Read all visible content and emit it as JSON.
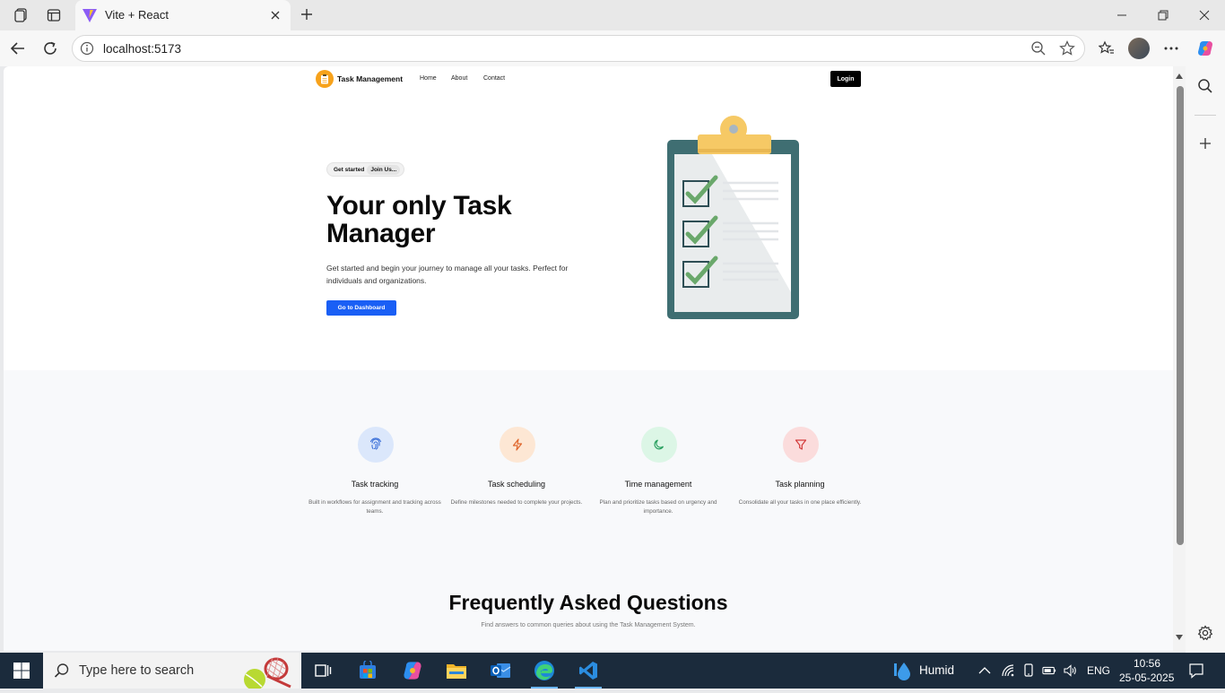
{
  "browser": {
    "tab_title": "Vite + React",
    "url": "localhost:5173"
  },
  "site": {
    "brand": "Task Management",
    "nav": [
      "Home",
      "About",
      "Contact"
    ],
    "login_label": "Login"
  },
  "hero": {
    "pill_left": "Get started",
    "pill_right": "Join Us...",
    "title": "Your only Task Manager",
    "subtitle": "Get started and begin your journey to manage all your tasks. Perfect for individuals and organizations.",
    "cta_label": "Go to Dashboard"
  },
  "features": [
    {
      "title": "Task tracking",
      "desc": "Built in workflows for assignment and tracking across teams.",
      "icon": "fingerprint-icon",
      "bg": "#dbe7fb",
      "fg": "#3a6fd8"
    },
    {
      "title": "Task scheduling",
      "desc": "Define milestones needed to complete your projects.",
      "icon": "lightning-icon",
      "bg": "#fde7d4",
      "fg": "#e0662c"
    },
    {
      "title": "Time management",
      "desc": "Plan and prioritize tasks based on urgency and importance.",
      "icon": "moon-icon",
      "bg": "#dcf6e6",
      "fg": "#2aa060"
    },
    {
      "title": "Task planning",
      "desc": "Consolidate all your tasks in one place efficiently.",
      "icon": "filter-icon",
      "bg": "#fbdcdc",
      "fg": "#d33b3b"
    }
  ],
  "faq": {
    "title": "Frequently Asked Questions",
    "subtitle": "Find answers to common queries about using the Task Management System."
  },
  "taskbar": {
    "search_placeholder": "Type here to search",
    "weather": "Humid",
    "language": "ENG",
    "time": "10:56",
    "date": "25-05-2025"
  }
}
